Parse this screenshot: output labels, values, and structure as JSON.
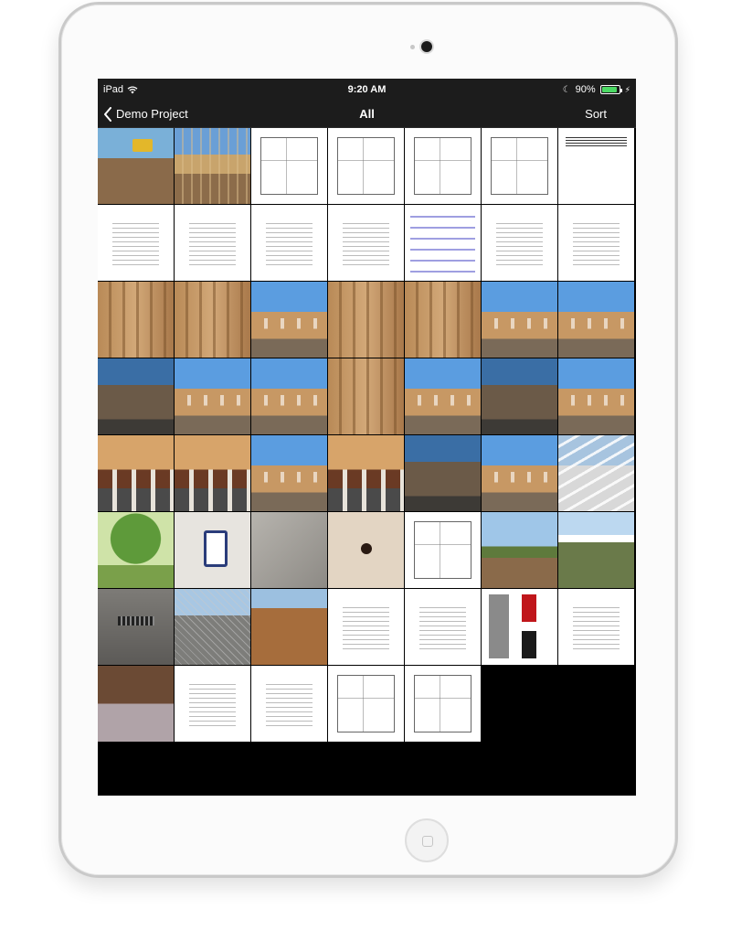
{
  "status_bar": {
    "device": "iPad",
    "time": "9:20 AM",
    "battery": "90%",
    "battery_level": 0.9
  },
  "nav": {
    "back_label": "Demo Project",
    "title": "All",
    "sort_label": "Sort"
  },
  "grid": {
    "tiles": [
      {
        "kind": "dirt"
      },
      {
        "kind": "framing"
      },
      {
        "kind": "plan"
      },
      {
        "kind": "plan"
      },
      {
        "kind": "plan"
      },
      {
        "kind": "plan"
      },
      {
        "kind": "cover"
      },
      {
        "kind": "doc"
      },
      {
        "kind": "doc"
      },
      {
        "kind": "doc"
      },
      {
        "kind": "doc"
      },
      {
        "kind": "gantt"
      },
      {
        "kind": "doc"
      },
      {
        "kind": "doc"
      },
      {
        "kind": "wood"
      },
      {
        "kind": "wood"
      },
      {
        "kind": "house"
      },
      {
        "kind": "wood"
      },
      {
        "kind": "wood"
      },
      {
        "kind": "house"
      },
      {
        "kind": "house"
      },
      {
        "kind": "house-dark"
      },
      {
        "kind": "house"
      },
      {
        "kind": "house"
      },
      {
        "kind": "wood"
      },
      {
        "kind": "house"
      },
      {
        "kind": "house-dark"
      },
      {
        "kind": "house"
      },
      {
        "kind": "porch"
      },
      {
        "kind": "porch"
      },
      {
        "kind": "house"
      },
      {
        "kind": "porch"
      },
      {
        "kind": "house-dark"
      },
      {
        "kind": "house"
      },
      {
        "kind": "rail"
      },
      {
        "kind": "tree"
      },
      {
        "kind": "outlet"
      },
      {
        "kind": "concrete"
      },
      {
        "kind": "wall-hole"
      },
      {
        "kind": "plan"
      },
      {
        "kind": "yard"
      },
      {
        "kind": "fence"
      },
      {
        "kind": "drain"
      },
      {
        "kind": "chainfence"
      },
      {
        "kind": "trench"
      },
      {
        "kind": "doc"
      },
      {
        "kind": "doc"
      },
      {
        "kind": "samples"
      },
      {
        "kind": "doc"
      },
      {
        "kind": "room"
      },
      {
        "kind": "doc"
      },
      {
        "kind": "doc"
      },
      {
        "kind": "plan"
      },
      {
        "kind": "plan"
      }
    ]
  }
}
